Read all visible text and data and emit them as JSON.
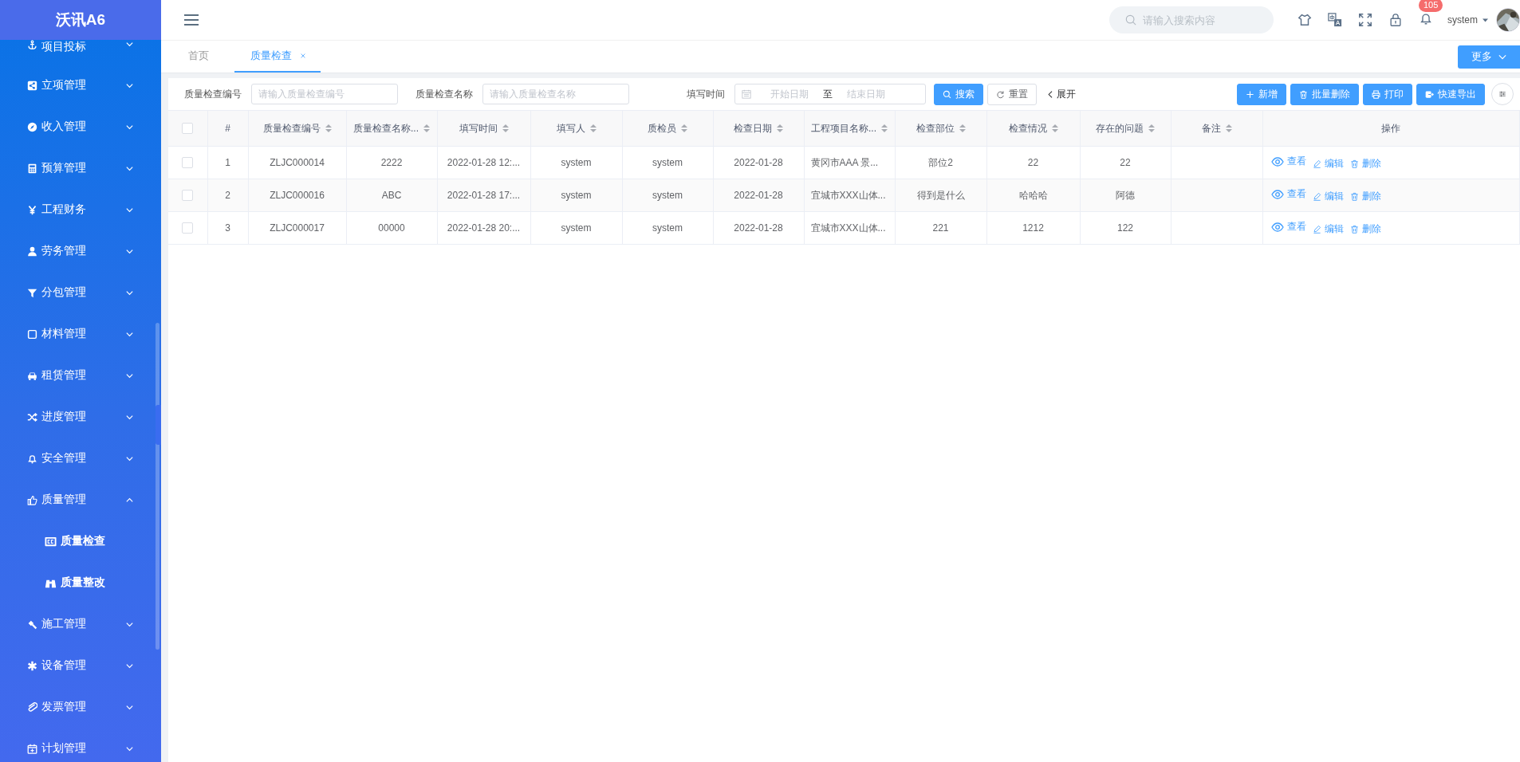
{
  "sidebar": {
    "logo": "沃讯A6",
    "items": [
      {
        "label": "项目投标",
        "expanded": false
      },
      {
        "label": "立项管理",
        "expanded": false
      },
      {
        "label": "收入管理",
        "expanded": false
      },
      {
        "label": "预算管理",
        "expanded": false
      },
      {
        "label": "工程财务",
        "expanded": false
      },
      {
        "label": "劳务管理",
        "expanded": false
      },
      {
        "label": "分包管理",
        "expanded": false
      },
      {
        "label": "材料管理",
        "expanded": false
      },
      {
        "label": "租赁管理",
        "expanded": false
      },
      {
        "label": "进度管理",
        "expanded": false
      },
      {
        "label": "安全管理",
        "expanded": false
      },
      {
        "label": "质量管理",
        "expanded": true,
        "children": [
          {
            "label": "质量检查"
          },
          {
            "label": "质量整改"
          }
        ]
      },
      {
        "label": "施工管理",
        "expanded": false
      },
      {
        "label": "设备管理",
        "expanded": false
      },
      {
        "label": "发票管理",
        "expanded": false
      },
      {
        "label": "计划管理",
        "expanded": false
      }
    ]
  },
  "header": {
    "search": {
      "placeholder": "请输入搜索内容"
    },
    "notifications": "105",
    "user": "system"
  },
  "tabs": [
    {
      "label": "首页",
      "selected": false,
      "closable": false
    },
    {
      "label": "质量检查",
      "selected": true,
      "closable": true
    }
  ],
  "more_button": "更多",
  "filters": [
    {
      "label": "质量检查编号",
      "placeholder": "请输入质量检查编号"
    },
    {
      "label": "质量检查名称",
      "placeholder": "请输入质量检查名称"
    }
  ],
  "date_filter": {
    "label": "填写时间",
    "start_placeholder": "开始日期",
    "separator": "至",
    "end_placeholder": "结束日期"
  },
  "search_button": "搜索",
  "reset_button": "重置",
  "expand_link": "展开",
  "toolbar": [
    {
      "label": "新增",
      "kind": "add"
    },
    {
      "label": "批量删除",
      "kind": "delete"
    },
    {
      "label": "打印",
      "kind": "print"
    },
    {
      "label": "快速导出",
      "kind": "export"
    }
  ],
  "table": {
    "select_all_checked": false,
    "columns": [
      {
        "label": "#",
        "sortable": false
      },
      {
        "label": "质量检查编号",
        "sortable": true
      },
      {
        "label": "质量检查名称...",
        "sortable": true
      },
      {
        "label": "填写时间",
        "sortable": true
      },
      {
        "label": "填写人",
        "sortable": true
      },
      {
        "label": "质检员",
        "sortable": true
      },
      {
        "label": "检查日期",
        "sortable": true
      },
      {
        "label": "工程项目名称...",
        "sortable": true
      },
      {
        "label": "检查部位",
        "sortable": true
      },
      {
        "label": "检查情况",
        "sortable": true
      },
      {
        "label": "存在的问题",
        "sortable": true
      },
      {
        "label": "备注",
        "sortable": true
      },
      {
        "label": "操作",
        "sortable": false
      }
    ],
    "rows": [
      {
        "checked": false,
        "cells": [
          "1",
          "ZLJC000014",
          "2222",
          "2022-01-28 12:...",
          "system",
          "system",
          "2022-01-28",
          "黄冈市AAA 景...",
          "部位2",
          "22",
          "22"
        ],
        "actions": [
          {
            "label": "查看",
            "kind": "view"
          },
          {
            "label": "编辑",
            "kind": "edit"
          },
          {
            "label": "删除",
            "kind": "delete"
          }
        ]
      },
      {
        "checked": false,
        "cells": [
          "2",
          "ZLJC000016",
          "ABC",
          "2022-01-28 17:...",
          "system",
          "system",
          "2022-01-28",
          "宜城市XXX山体...",
          "得到是什么",
          "哈哈哈",
          "阿德"
        ],
        "actions": [
          {
            "label": "查看",
            "kind": "view"
          },
          {
            "label": "编辑",
            "kind": "edit"
          },
          {
            "label": "删除",
            "kind": "delete"
          }
        ]
      },
      {
        "checked": false,
        "cells": [
          "3",
          "ZLJC000017",
          "00000",
          "2022-01-28 20:...",
          "system",
          "system",
          "2022-01-28",
          "宜城市XXX山体...",
          "221",
          "1212",
          "122"
        ],
        "actions": [
          {
            "label": "查看",
            "kind": "view"
          },
          {
            "label": "编辑",
            "kind": "edit"
          },
          {
            "label": "删除",
            "kind": "delete"
          }
        ]
      }
    ]
  }
}
